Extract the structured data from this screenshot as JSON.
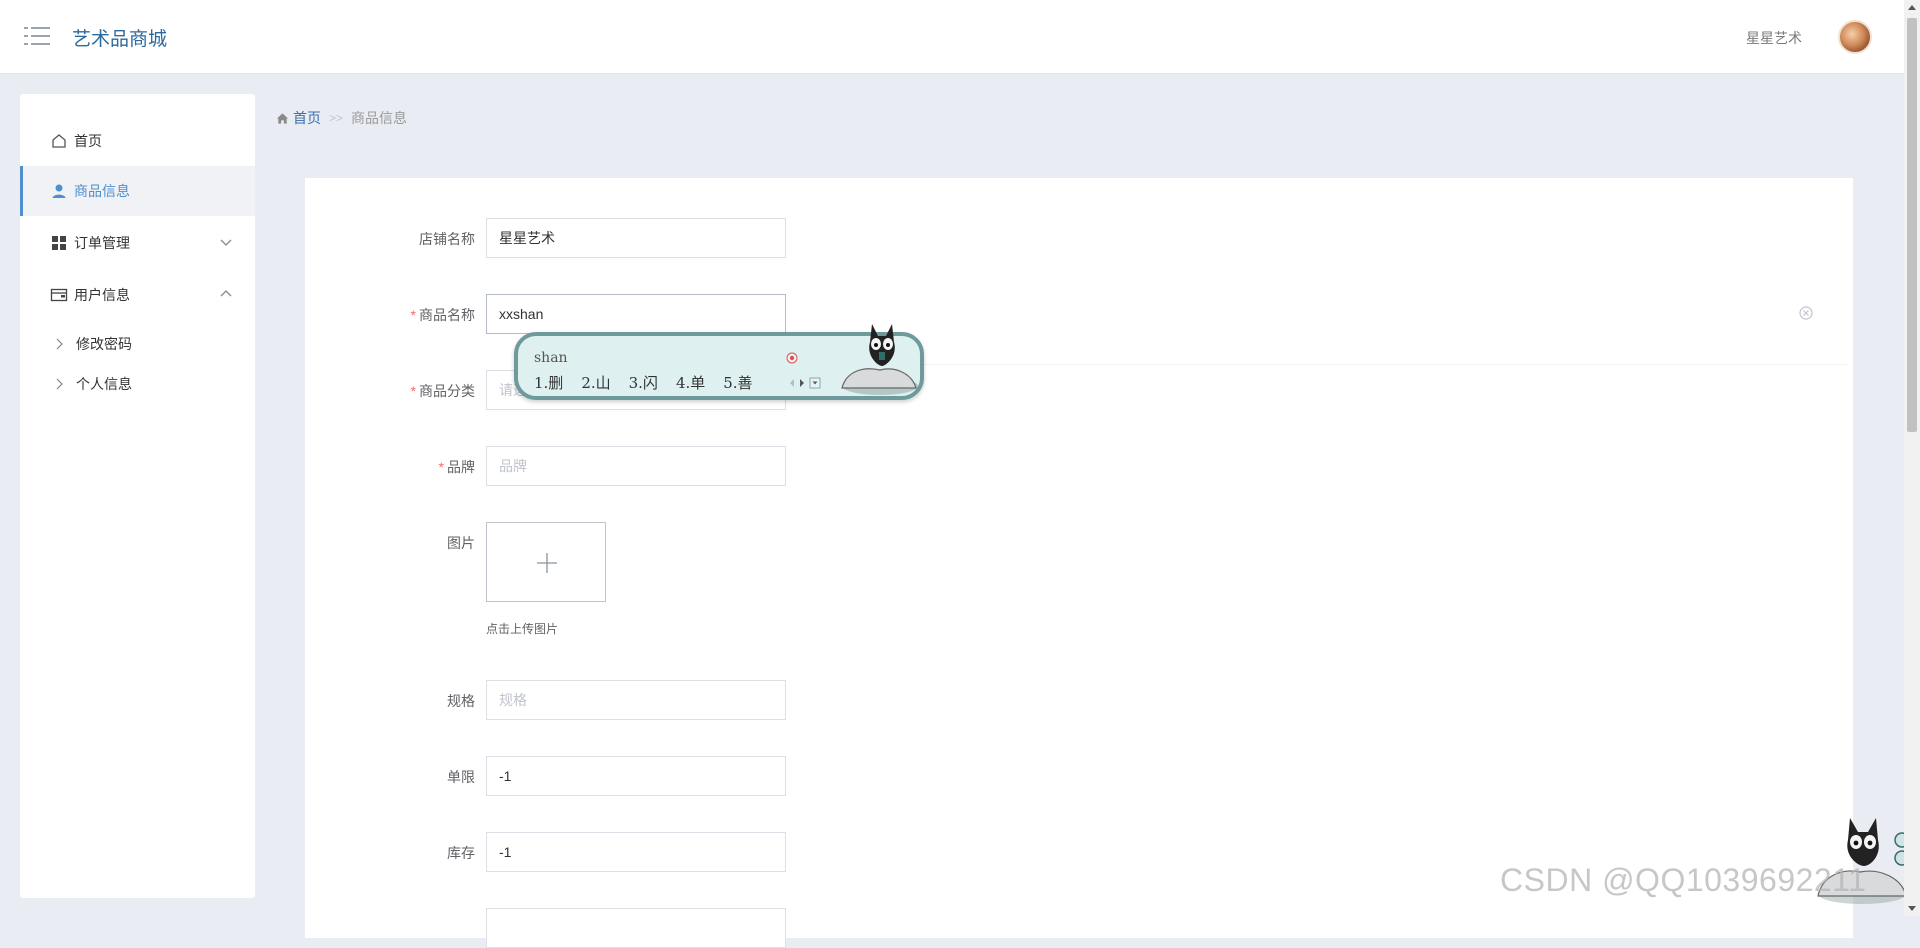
{
  "header": {
    "app_title": "艺术品商城",
    "user_name": "星星艺术"
  },
  "sidebar": {
    "items": [
      {
        "label": "首页",
        "icon": "home-icon"
      },
      {
        "label": "商品信息",
        "icon": "user-icon",
        "active": true
      },
      {
        "label": "订单管理",
        "icon": "grid-icon",
        "expanded": false
      },
      {
        "label": "用户信息",
        "icon": "wallet-icon",
        "expanded": true
      }
    ],
    "sub_items": [
      {
        "label": "修改密码"
      },
      {
        "label": "个人信息"
      }
    ]
  },
  "breadcrumb": {
    "home": "首页",
    "separator": ">>",
    "current": "商品信息"
  },
  "form": {
    "shop_name": {
      "label": "店铺名称",
      "value": "星星艺术"
    },
    "product_name": {
      "label": "商品名称",
      "value": "xxshan",
      "required": true
    },
    "category": {
      "label": "商品分类",
      "placeholder": "请选",
      "required": true
    },
    "brand": {
      "label": "品牌",
      "placeholder": "品牌",
      "required": true
    },
    "image": {
      "label": "图片",
      "upload_tip": "点击上传图片"
    },
    "spec": {
      "label": "规格",
      "placeholder": "规格"
    },
    "limit": {
      "label": "单限",
      "value": "-1"
    },
    "stock": {
      "label": "库存",
      "value": "-1"
    }
  },
  "ime": {
    "input": "shan",
    "candidates": [
      "1.删",
      "2.山",
      "3.闪",
      "4.单",
      "5.善"
    ]
  },
  "watermark": "CSDN @QQ1039692211",
  "colors": {
    "accent": "#4f8fd0",
    "title": "#2d6a9f",
    "background": "#e9edf3",
    "required": "#f56c6c"
  }
}
